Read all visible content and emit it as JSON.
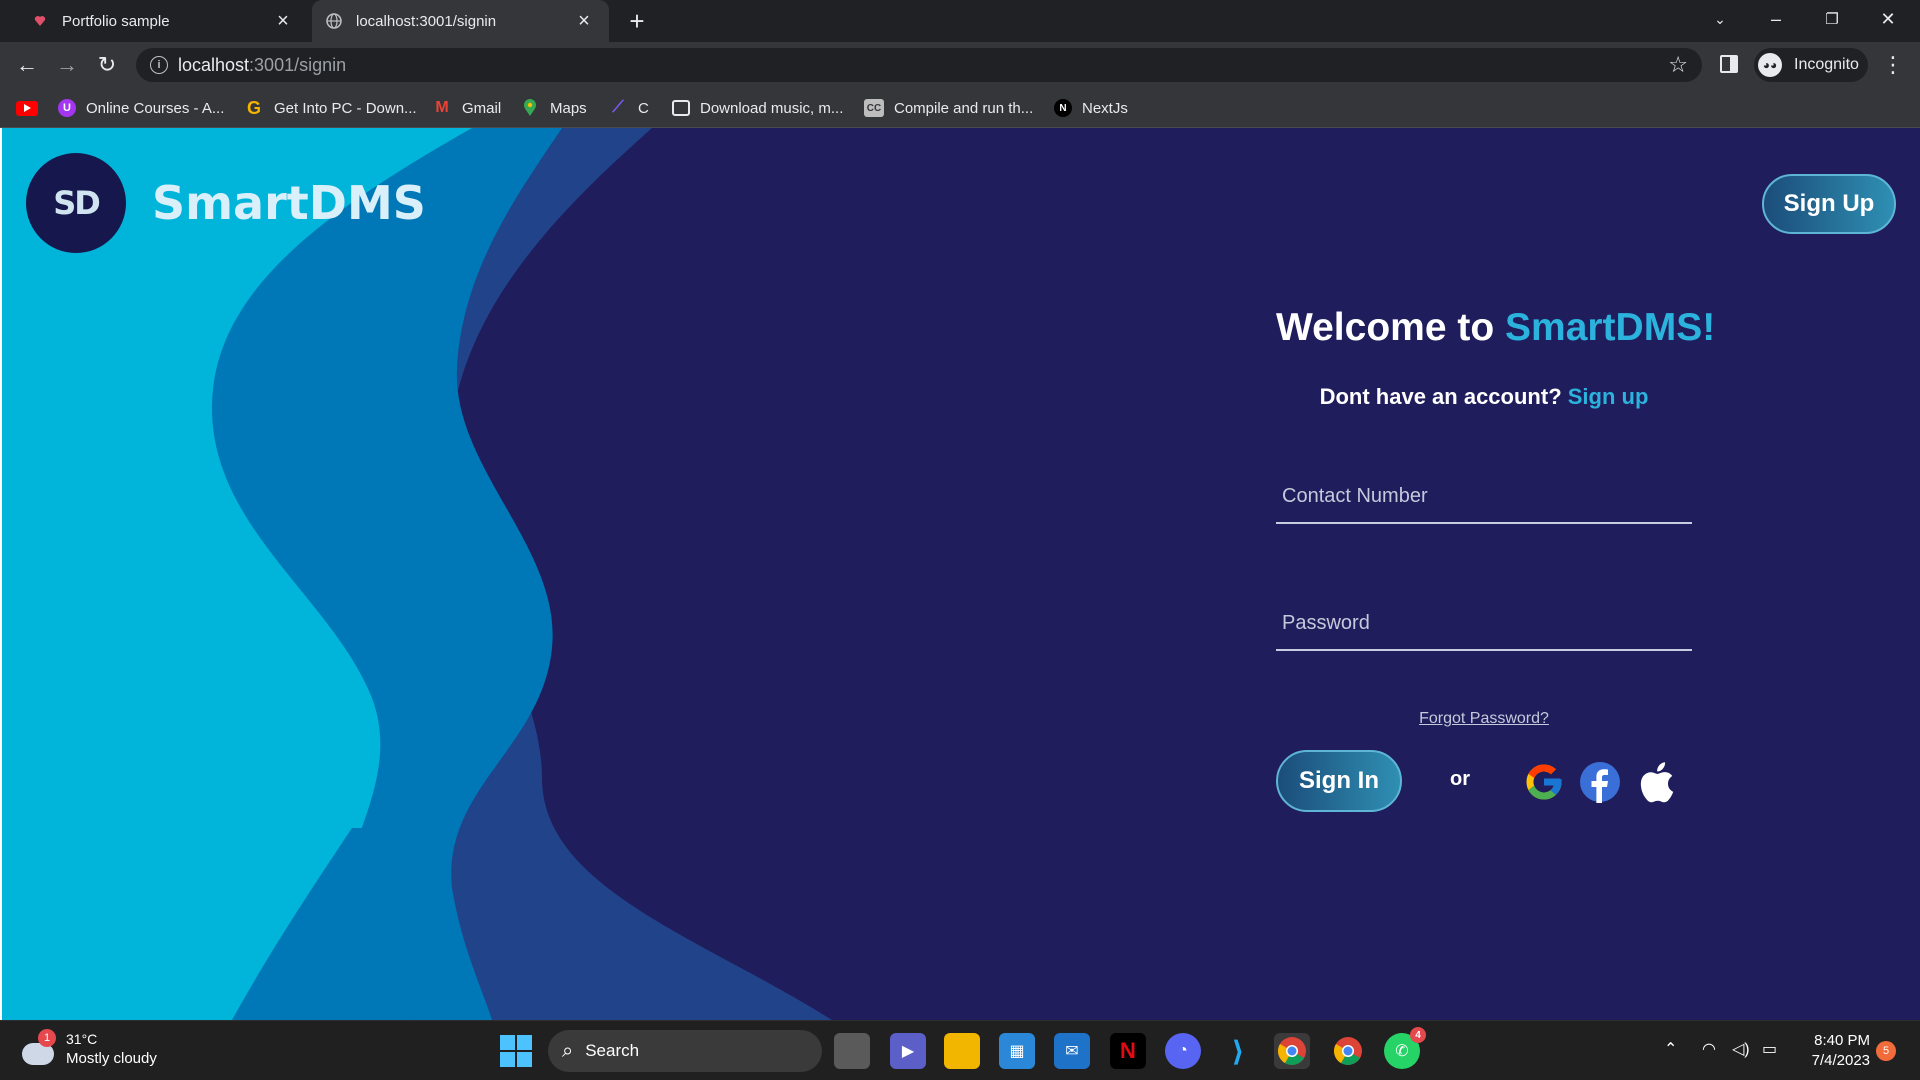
{
  "browser": {
    "tabs": [
      {
        "title": "Portfolio sample",
        "active": false
      },
      {
        "title": "localhost:3001/signin",
        "active": true
      }
    ],
    "address": {
      "host": "localhost",
      "path": ":3001/signin"
    },
    "profile_label": "Incognito",
    "bookmarks": [
      {
        "label": "",
        "icon": "youtube-icon"
      },
      {
        "label": "Online Courses - A...",
        "icon": "udemy-icon"
      },
      {
        "label": "Get Into PC - Down...",
        "icon": "getintopc-icon"
      },
      {
        "label": "Gmail",
        "icon": "gmail-icon"
      },
      {
        "label": "Maps",
        "icon": "maps-icon"
      },
      {
        "label": "C",
        "icon": "c-icon"
      },
      {
        "label": "Download music, m...",
        "icon": "download-icon"
      },
      {
        "label": "Compile and run th...",
        "icon": "compiler-icon"
      },
      {
        "label": "NextJs",
        "icon": "nextjs-icon"
      }
    ]
  },
  "page": {
    "logo_text": "SD",
    "brand": "SmartDMS",
    "signup_button": "Sign Up",
    "welcome_prefix": "Welcome to ",
    "welcome_accent": "SmartDMS!",
    "no_account_text": "Dont have an account? ",
    "no_account_link": "Sign up",
    "contact_placeholder": "Contact Number",
    "password_placeholder": "Password",
    "forgot_password": "Forgot Password?",
    "signin_button": "Sign In",
    "or_text": "or",
    "colors": {
      "background": "#1f1d5b",
      "accent": "#2bb3dd",
      "wave_light": "#00b4da",
      "wave_mid": "#0077b6",
      "wave_dark": "#21438a"
    }
  },
  "taskbar": {
    "weather_temp": "31°C",
    "weather_desc": "Mostly cloudy",
    "weather_badge": "1",
    "search_label": "Search",
    "whatsapp_badge": "4",
    "time": "8:40 PM",
    "date": "7/4/2023",
    "notification_count": "5"
  }
}
